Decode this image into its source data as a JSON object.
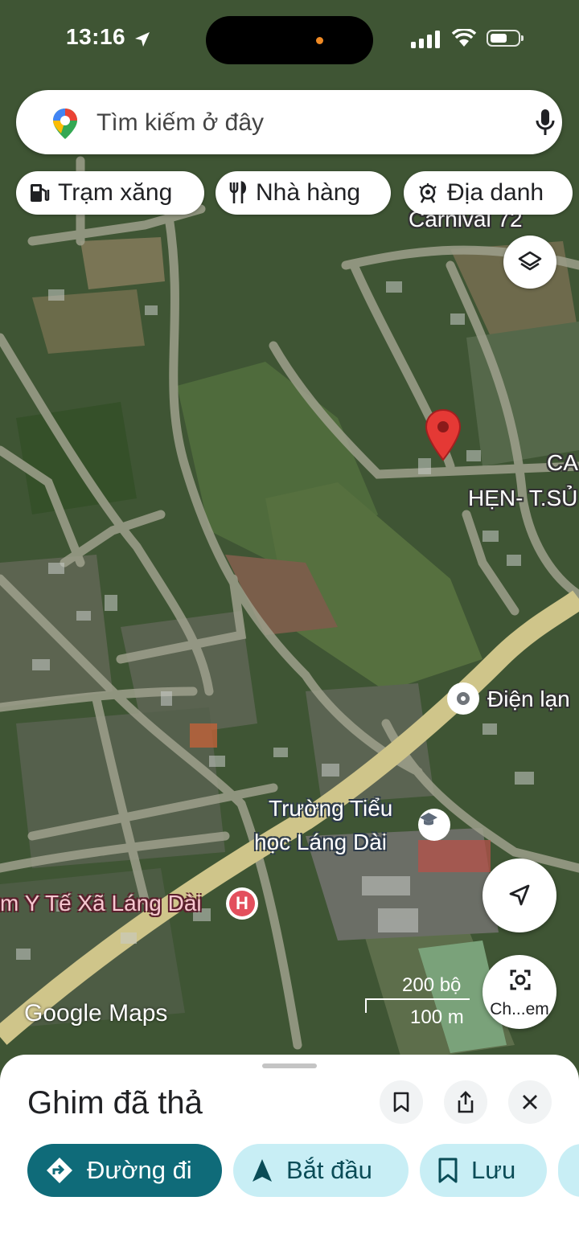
{
  "status_bar": {
    "time": "13:16"
  },
  "search": {
    "placeholder": "Tìm kiếm ở đây"
  },
  "chips": [
    {
      "label": "Trạm xăng",
      "icon": "gas-station-icon"
    },
    {
      "label": "Nhà hàng",
      "icon": "restaurant-icon"
    },
    {
      "label": "Địa danh",
      "icon": "landmark-icon"
    }
  ],
  "map": {
    "labels": {
      "carnival": "Carnival 72",
      "ca": "CA",
      "hen": "HẸN- T.SỦ",
      "dien": "Điện lạn",
      "school_line1": "Trường Tiểu",
      "school_line2": "học Láng Dài",
      "health": "m Y Tế Xã Láng Dài"
    },
    "scale": {
      "top": "200 bộ",
      "bottom": "100 m"
    },
    "attribution": "Google Maps",
    "lens_label": "Ch...em"
  },
  "sheet": {
    "title": "Ghim đã thả",
    "buttons": {
      "directions": "Đường đi",
      "start": "Bắt đầu",
      "save": "Lưu"
    }
  },
  "colors": {
    "primary_button": "#0f6b79",
    "secondary_button": "#c8eef5",
    "pin": "#e53935",
    "road_main": "#cfc58a"
  }
}
